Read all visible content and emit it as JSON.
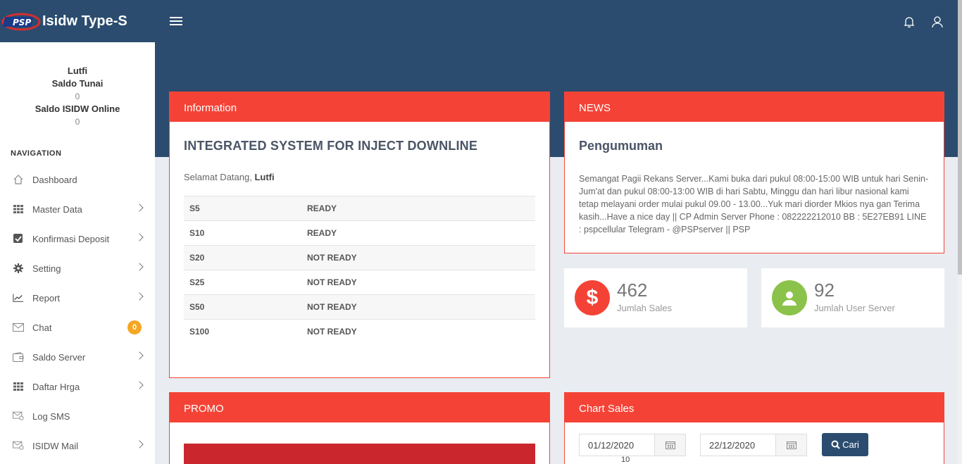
{
  "app": {
    "title": "Isidw Type-S",
    "logo_text": "PSP"
  },
  "user": {
    "name": "Lutfi",
    "saldo_tunai_label": "Saldo Tunai",
    "saldo_tunai_value": "0",
    "saldo_online_label": "Saldo ISIDW Online",
    "saldo_online_value": "0"
  },
  "nav": {
    "title": "NAVIGATION",
    "items": [
      {
        "label": "Dashboard",
        "icon": "home-icon"
      },
      {
        "label": "Master Data",
        "icon": "grid-icon"
      },
      {
        "label": "Konfirmasi Deposit",
        "icon": "checkbox-icon"
      },
      {
        "label": "Setting",
        "icon": "gear-icon"
      },
      {
        "label": "Report",
        "icon": "chart-line-icon"
      },
      {
        "label": "Chat",
        "icon": "mail-icon",
        "badge": "0"
      },
      {
        "label": "Saldo Server",
        "icon": "wallet-icon"
      },
      {
        "label": "Daftar Hrga",
        "icon": "grid-icon"
      },
      {
        "label": "Log SMS",
        "icon": "sms-icon"
      },
      {
        "label": "ISIDW Mail",
        "icon": "mail-icon"
      }
    ]
  },
  "info": {
    "header": "Information",
    "title": "INTEGRATED SYSTEM FOR INJECT DOWNLINE",
    "welcome_prefix": "Selamat Datang,",
    "welcome_name": "Lutfi",
    "rows": [
      {
        "code": "S5",
        "status": "READY"
      },
      {
        "code": "S10",
        "status": "READY"
      },
      {
        "code": "S20",
        "status": "NOT READY"
      },
      {
        "code": "S25",
        "status": "NOT READY"
      },
      {
        "code": "S50",
        "status": "NOT READY"
      },
      {
        "code": "S100",
        "status": "NOT READY"
      }
    ]
  },
  "news": {
    "header": "NEWS",
    "title": "Pengumuman",
    "body": "Semangat Pagii Rekans Server...Kami buka dari pukul 08:00-15:00 WIB untuk hari Senin-Jum'at dan pukul 08:00-13:00 WIB di hari Sabtu, Minggu dan hari libur nasional kami tetap melayani order mulai pukul 09.00 - 13.00...Yuk mari diorder Mkios nya gan Terima kasih...Have a nice day || CP Admin Server Phone : 082222212010 BB : 5E27EB91 LINE : pspcellular Telegram - @PSPserver || PSP"
  },
  "stats": {
    "sales": {
      "value": "462",
      "label": "Jumlah Sales",
      "color": "#f44336"
    },
    "users": {
      "value": "92",
      "label": "Jumlah User Server",
      "color": "#8bc34a"
    }
  },
  "promo": {
    "header": "PROMO"
  },
  "chart": {
    "header": "Chart Sales",
    "date_from": "01/12/2020",
    "date_to": "22/12/2020",
    "button": "Cari",
    "y_top_tick": "10"
  },
  "colors": {
    "accent": "#f44336",
    "header_bg": "#2b4c6f"
  }
}
